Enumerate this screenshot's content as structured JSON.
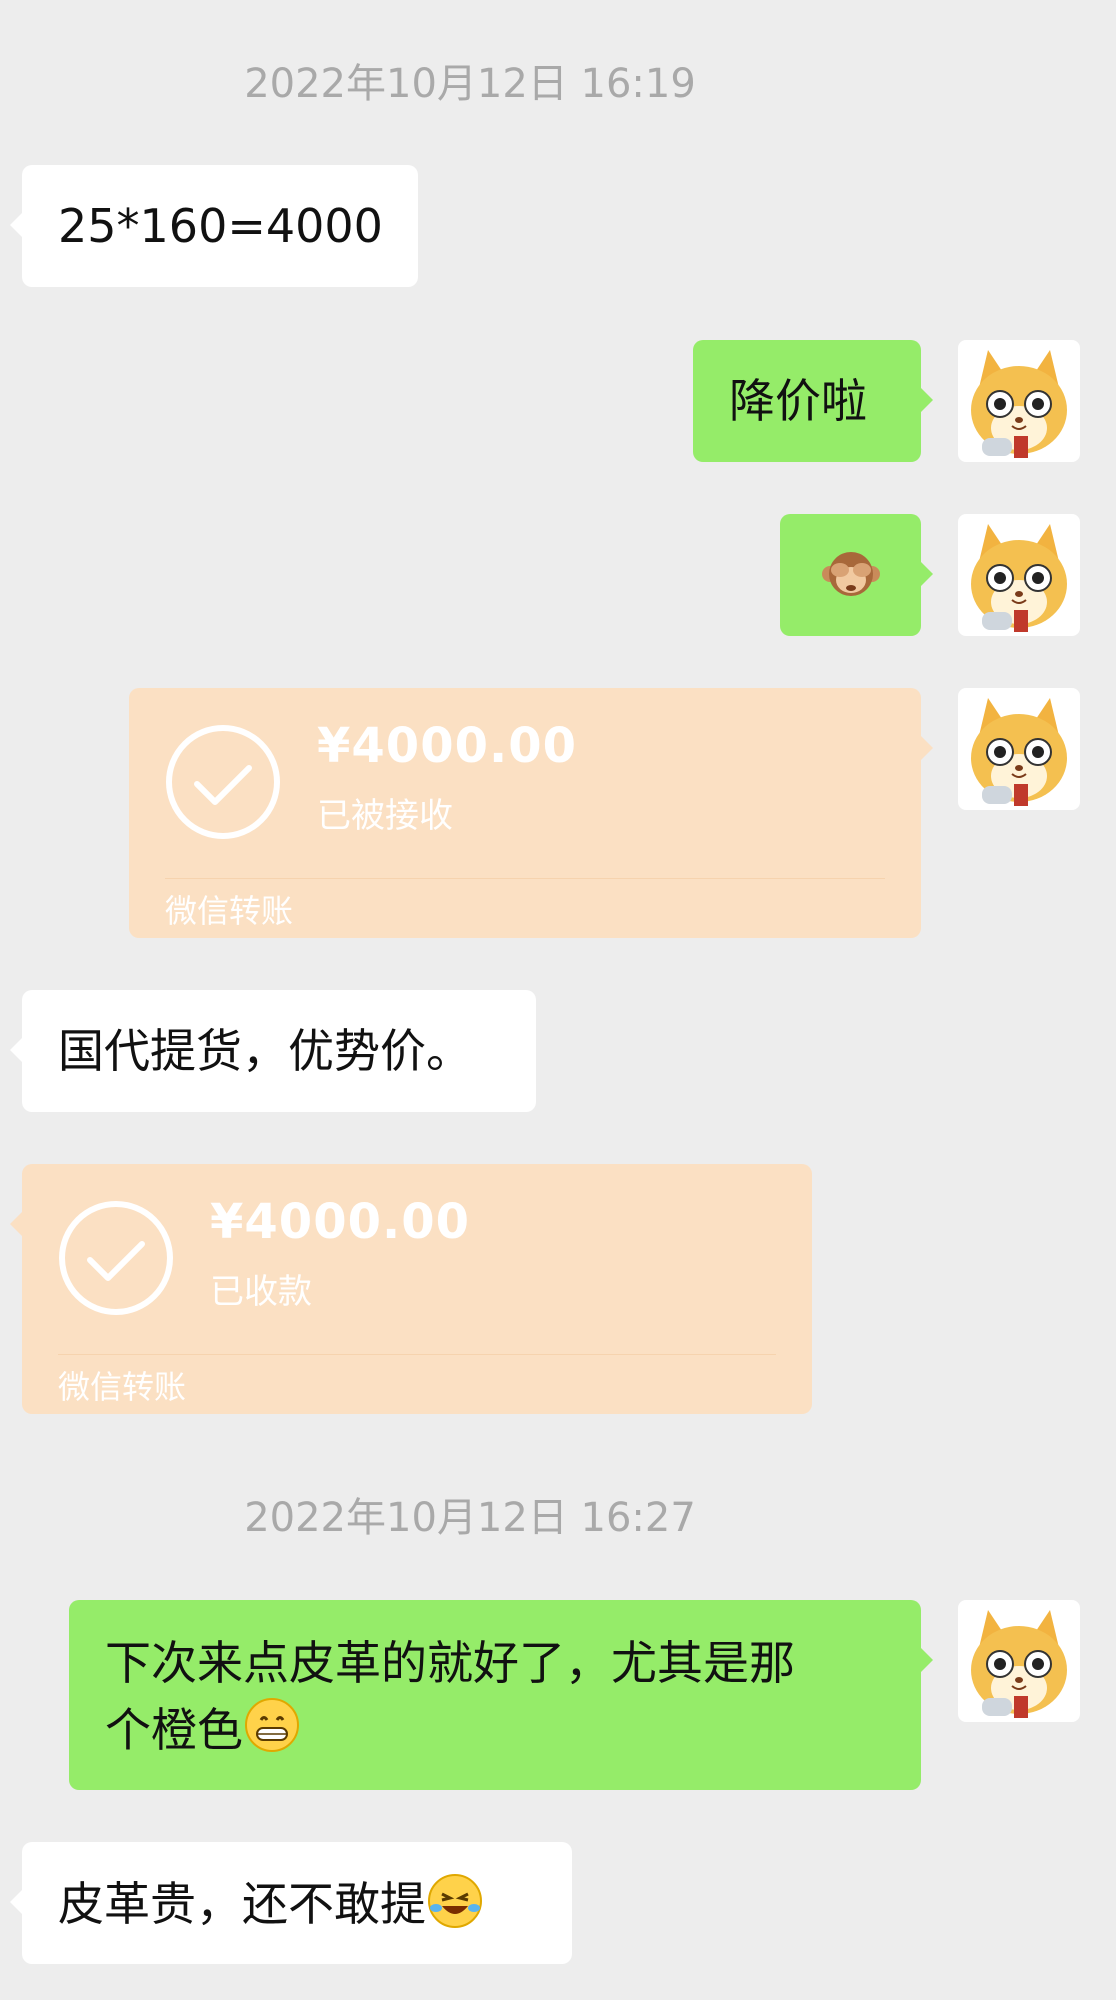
{
  "colors": {
    "background": "#ededed",
    "bubble_received": "#ffffff",
    "bubble_sent": "#95ec69",
    "transfer_card": "#fbe0c3",
    "timestamp_text": "#a9a9a9"
  },
  "timestamps": [
    "2022年10月12日 16:19",
    "2022年10月12日 16:27"
  ],
  "messages": {
    "m1": {
      "side": "left",
      "text": "25*160=4000"
    },
    "m2": {
      "side": "right",
      "text": "降价啦"
    },
    "m3": {
      "side": "right",
      "emoji": "see-no-evil-monkey-icon"
    },
    "m4": {
      "side": "right",
      "type": "transfer",
      "amount": "¥4000.00",
      "status": "已被接收",
      "footer": "微信转账"
    },
    "m5": {
      "side": "left",
      "text": "国代提货，优势价。"
    },
    "m6": {
      "side": "left",
      "type": "transfer",
      "amount": "¥4000.00",
      "status": "已收款",
      "footer": "微信转账"
    },
    "m7": {
      "side": "right",
      "text_line1": "下次来点皮革的就好了，尤其是那",
      "text_line2": "个橙色",
      "emoji": "grinning-face-icon"
    },
    "m8": {
      "side": "left",
      "text": "皮革贵，还不敢提",
      "emoji": "laughing-tears-icon"
    }
  },
  "avatar": {
    "name": "cat-avatar-icon"
  }
}
